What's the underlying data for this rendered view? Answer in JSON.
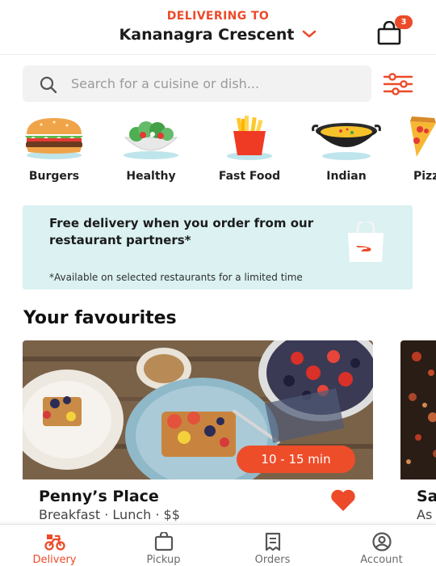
{
  "header": {
    "delivering_label": "DELIVERING TO",
    "address": "Kananagra Crescent",
    "cart_count": "3"
  },
  "search": {
    "placeholder": "Search for a cuisine or dish..."
  },
  "categories": [
    {
      "label": "Burgers",
      "icon": "burger-icon"
    },
    {
      "label": "Healthy",
      "icon": "salad-icon"
    },
    {
      "label": "Fast Food",
      "icon": "fries-icon"
    },
    {
      "label": "Indian",
      "icon": "curry-pot-icon"
    },
    {
      "label": "Pizz",
      "icon": "pizza-icon"
    }
  ],
  "promo": {
    "title": "Free delivery when you order from our restaurant partners*",
    "note": "*Available on selected restaurants for a limited time",
    "icon": "shopping-bag-icon"
  },
  "favourites": {
    "title": "Your favourites",
    "cards": [
      {
        "name": "Penny’s Place",
        "tags": "Breakfast · Lunch · $$",
        "time": "10 - 15 min",
        "favourited": true
      },
      {
        "name": "Sa",
        "tags": "As"
      }
    ]
  },
  "nav": {
    "items": [
      {
        "label": "Delivery",
        "icon": "scooter-icon",
        "active": true
      },
      {
        "label": "Pickup",
        "icon": "bag-icon",
        "active": false
      },
      {
        "label": "Orders",
        "icon": "receipt-icon",
        "active": false
      },
      {
        "label": "Account",
        "icon": "account-icon",
        "active": false
      }
    ]
  },
  "colors": {
    "accent": "#ec4a28",
    "promo_bg": "#dbf1f2"
  }
}
